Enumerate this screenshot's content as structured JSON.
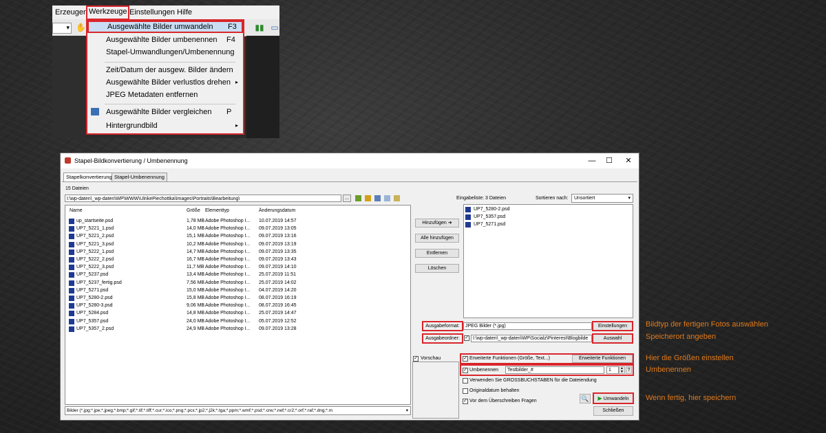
{
  "menu_screenshot": {
    "menubar": [
      "Erzeugen",
      "Werkzeuge",
      "Einstellungen",
      "Hilfe"
    ],
    "items": [
      {
        "label": "Ausgewählte Bilder umwandeln",
        "shortcut": "F3"
      },
      {
        "label": "Ausgewählte Bilder umbenennen",
        "shortcut": "F4"
      },
      {
        "label": "Stapel-Umwandlungen/Umbenennung",
        "shortcut": ""
      },
      {
        "label": "Zeit/Datum der ausgew. Bilder ändern",
        "shortcut": ""
      },
      {
        "label": "Ausgewählte Bilder verlustlos drehen",
        "shortcut": "▸"
      },
      {
        "label": "JPEG Metadaten entfernen",
        "shortcut": ""
      },
      {
        "label": "Ausgewählte Bilder vergleichen",
        "shortcut": "P"
      },
      {
        "label": "Hintergrundbild",
        "shortcut": "▸"
      }
    ]
  },
  "dialog": {
    "title": "Stapel-Bildkonvertierung / Umbenennung",
    "window_buttons": [
      "—",
      "☐",
      "✕"
    ],
    "tabs": [
      "Stapelkonvertierung",
      "Stapel-Umbenennung"
    ],
    "file_count": "15 Dateien",
    "path": "I:\\wp-daten\\_wp-daten\\WP\\WWW\\UlrikePiechottka\\Images\\Portraits\\Bearbeitung\\",
    "browse_label": "...",
    "columns": [
      "Name",
      "Größe",
      "Elementtyp",
      "Änderungsdatum"
    ],
    "files": [
      [
        "up_startseite.psd",
        "1,78 MB",
        "Adobe Photoshop I...",
        "10.07.2019 14:57"
      ],
      [
        "UP7_5221_1.psd",
        "14,0 MB",
        "Adobe Photoshop I...",
        "09.07.2019 13:05"
      ],
      [
        "UP7_5221_2.psd",
        "15,1 MB",
        "Adobe Photoshop I...",
        "09.07.2019 13:16"
      ],
      [
        "UP7_5221_3.psd",
        "10,2 MB",
        "Adobe Photoshop I...",
        "09.07.2019 13:19"
      ],
      [
        "UP7_5222_1.psd",
        "14,7 MB",
        "Adobe Photoshop I...",
        "09.07.2019 13:35"
      ],
      [
        "UP7_5222_2.psd",
        "16,7 MB",
        "Adobe Photoshop I...",
        "09.07.2019 13:43"
      ],
      [
        "UP7_5222_3.psd",
        "11,7 MB",
        "Adobe Photoshop I...",
        "09.07.2019 14:10"
      ],
      [
        "UP7_5237.psd",
        "13,4 MB",
        "Adobe Photoshop I...",
        "25.07.2019 11:51"
      ],
      [
        "UP7_5237_fertig.psd",
        "7,56 MB",
        "Adobe Photoshop I...",
        "25.07.2019 14:02"
      ],
      [
        "UP7_5271.psd",
        "15,0 MB",
        "Adobe Photoshop I...",
        "04.07.2019 14:20"
      ],
      [
        "UP7_5280-2.psd",
        "15,8 MB",
        "Adobe Photoshop I...",
        "08.07.2019 16:19"
      ],
      [
        "UP7_5280-3.psd",
        "9,06 MB",
        "Adobe Photoshop I...",
        "08.07.2019 16:45"
      ],
      [
        "UP7_5284.psd",
        "14,8 MB",
        "Adobe Photoshop I...",
        "25.07.2019 14:47"
      ],
      [
        "UP7_5357.psd",
        "24,0 MB",
        "Adobe Photoshop I...",
        "05.07.2019 12:52"
      ],
      [
        "UP7_5357_2.psd",
        "24,9 MB",
        "Adobe Photoshop I...",
        "09.07.2019 13:28"
      ]
    ],
    "filter": "Bilder (*.jpg;*.jpe;*.jpeg;*.bmp;*.gif;*.tif;*.tiff;*.cur;*.ico;*.png;*.pcx;*.jp2;*.j2k;*.tga;*.ppm;*.wmf;*.psd;*.crw;*.nef;*.cr2;*.orf;*.raf;*.dng;*.m",
    "buttons": {
      "add": "Hinzufügen ➜",
      "add_all": "Alle hinzufügen",
      "remove": "Entfernen",
      "delete": "Löschen"
    },
    "input_list_label": "Eingabeliste: 3 Dateien",
    "sort_label": "Sortieren nach:",
    "sort_value": "Unsortiert",
    "input_files": [
      "UP7_5280-2.psd",
      "UP7_5357.psd",
      "UP7_5271.psd"
    ],
    "output_format_label": "Ausgabeformat:",
    "output_format_value": "JPEG Bilder (*.jpg)",
    "settings_button": "Einstellungen",
    "output_folder_label": "Ausgabeordner:",
    "output_folder_value": "I:\\wp-daten\\_wp-daten\\WP\\Socialz\\Pinterest\\Blogbilde",
    "choose_button": "Auswahl",
    "preview_label": "Vorschau",
    "advanced_label": "Erweiterte Funktionen (Größe, Text...)",
    "advanced_button": "Erweiterte Funktionen",
    "rename_label": "Umbenennen",
    "rename_pattern": "Testbilder_#",
    "rename_start": "1",
    "help_label": "?",
    "uppercase_label": "Verwenden Sie GROSSBUCHSTABEN für die Dateiendung",
    "keep_date_label": "Originaldatum behalten",
    "ask_overwrite_label": "Vor dem Überschreiben Fragen",
    "convert_button": "Umwandeln",
    "close_button": "Schließen"
  },
  "annotations": {
    "format": "Bildtyp der fertigen Fotos auswählen",
    "folder": "Speicherort angeben",
    "size": "Hier die Größen einstellen",
    "rename": "Umbenennen",
    "save": "Wenn fertig, hier speichern"
  },
  "colors": {
    "highlight": "#d9252b",
    "annotation": "#e07a1c"
  }
}
